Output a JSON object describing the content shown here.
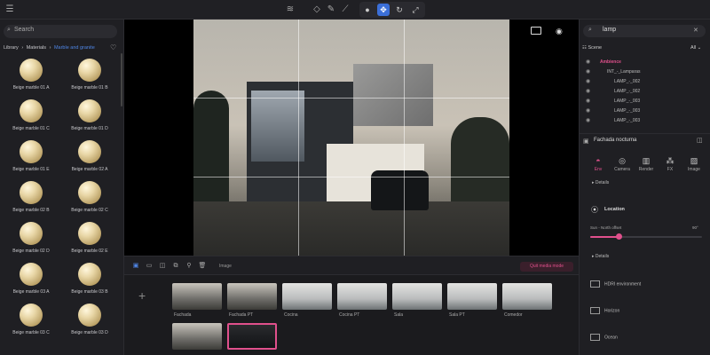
{
  "search": {
    "placeholder": "Search"
  },
  "library": {
    "crumbs": [
      "Library",
      "›",
      "Materials",
      "›",
      "Marble and granite"
    ],
    "materials": [
      "Beige marble 01 A",
      "Beige marble 01 B",
      "Beige marble 01 C",
      "Beige marble 01 D",
      "Beige marble 01 E",
      "Beige marble 02 A",
      "Beige marble 02 B",
      "Beige marble 02 C",
      "Beige marble 02 D",
      "Beige marble 02 E",
      "Beige marble 03 A",
      "Beige marble 03 B",
      "Beige marble 03 C",
      "Beige marble 03 D"
    ]
  },
  "timeline": {
    "image_label": "Image",
    "quit_label": "Quit media mode",
    "shots": [
      {
        "label": "Fachada",
        "kind": "exterior"
      },
      {
        "label": "Fachada PT",
        "kind": "exterior"
      },
      {
        "label": "Cocina",
        "kind": "interior"
      },
      {
        "label": "Cocina PT",
        "kind": "interior"
      },
      {
        "label": "Sala",
        "kind": "interior"
      },
      {
        "label": "Sala PT",
        "kind": "interior"
      },
      {
        "label": "Comedor",
        "kind": "interior"
      },
      {
        "label": "",
        "kind": "exterior"
      },
      {
        "label": "",
        "kind": "night",
        "selected": true
      }
    ]
  },
  "right": {
    "search_value": "lamp",
    "scene_label": "Scene",
    "filter_label": "All",
    "tree": [
      {
        "name": "Ambience",
        "amb": true,
        "indent": 0
      },
      {
        "name": "INT_-_Lamparas",
        "indent": 1
      },
      {
        "name": "LAMP_-_002",
        "indent": 2
      },
      {
        "name": "LAMP_-_002",
        "indent": 2
      },
      {
        "name": "LAMP_-_003",
        "indent": 2
      },
      {
        "name": "LAMP_-_003",
        "indent": 2
      },
      {
        "name": "LAMP_-_003",
        "indent": 2
      }
    ],
    "camera_name": "Fachada nocturna",
    "tabs": [
      "Env",
      "Camera",
      "Render",
      "FX",
      "Image"
    ],
    "details_label": "Details",
    "location_label": "Location",
    "sun_label": "Sun - North offset",
    "sun_value": "90°",
    "sun_fraction": 0.25,
    "env_rows": [
      "HDRI environment",
      "Horizon",
      "Ocean"
    ]
  },
  "colors": {
    "accent": "#e0508c",
    "blue": "#3b6fd8"
  }
}
